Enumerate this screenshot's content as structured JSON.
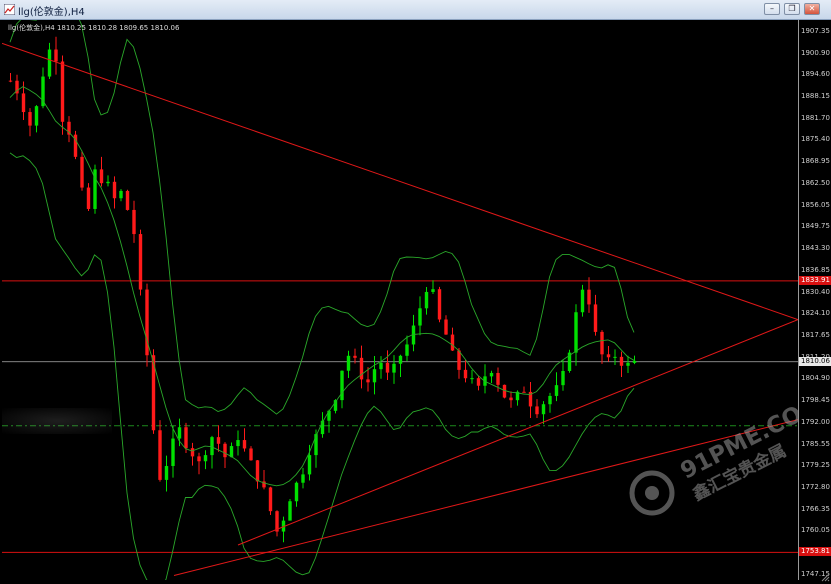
{
  "window": {
    "title": "llg(伦敦金),H4",
    "buttons": [
      "minimize-button",
      "restore-button",
      "close-button"
    ]
  },
  "chart_info": {
    "symbol_line": "llg(伦敦金),H4  1810.25 1810.28 1809.65 1810.06"
  },
  "price_axis": {
    "ticks": [
      "1907.35",
      "1900.90",
      "1894.60",
      "1888.15",
      "1881.70",
      "1875.40",
      "1868.95",
      "1862.50",
      "1856.05",
      "1849.75",
      "1843.30",
      "1836.85",
      "1830.40",
      "1824.10",
      "1817.65",
      "1811.20",
      "1804.90",
      "1798.45",
      "1792.00",
      "1785.55",
      "1779.25",
      "1772.80",
      "1766.35",
      "1760.05",
      "1753.60",
      "1747.15"
    ],
    "current_price": "1810.06",
    "resistance_tag": "1833.91",
    "support_tag": "1753.81",
    "colors": {
      "bull": "#00e000",
      "bear": "#ff1a1a",
      "band": "#2aa82a",
      "trend": "#e01818",
      "level": "#d81010",
      "current": "#b0b0b0",
      "dashed": "#1c8a1c"
    }
  },
  "watermark": {
    "text_main": "91PME.COM",
    "text_sub": "鑫汇宝贵金属"
  },
  "chart_data": {
    "type": "candlestick",
    "timeframe": "H4",
    "ylim": [
      1747.15,
      1907.35
    ],
    "close_path": [
      1893,
      1890,
      1885,
      1880,
      1885,
      1895,
      1902,
      1900,
      1882,
      1878,
      1870,
      1860,
      1855,
      1866,
      1864,
      1862,
      1858,
      1860,
      1855,
      1848,
      1830,
      1812,
      1790,
      1776,
      1780,
      1786,
      1790,
      1786,
      1783,
      1780,
      1784,
      1788,
      1786,
      1782,
      1784,
      1788,
      1784,
      1780,
      1776,
      1772,
      1766,
      1760,
      1764,
      1770,
      1774,
      1778,
      1784,
      1788,
      1792,
      1796,
      1800,
      1808,
      1812,
      1810,
      1806,
      1804,
      1808,
      1810,
      1806,
      1808,
      1812,
      1815,
      1820,
      1826,
      1832,
      1830,
      1822,
      1818,
      1812,
      1808,
      1806,
      1804,
      1802,
      1806,
      1808,
      1804,
      1800,
      1798,
      1800,
      1802,
      1798,
      1796,
      1798,
      1800,
      1802,
      1806,
      1814,
      1824,
      1832,
      1828,
      1818,
      1812,
      1810,
      1812,
      1810,
      1809,
      1810
    ]
  }
}
